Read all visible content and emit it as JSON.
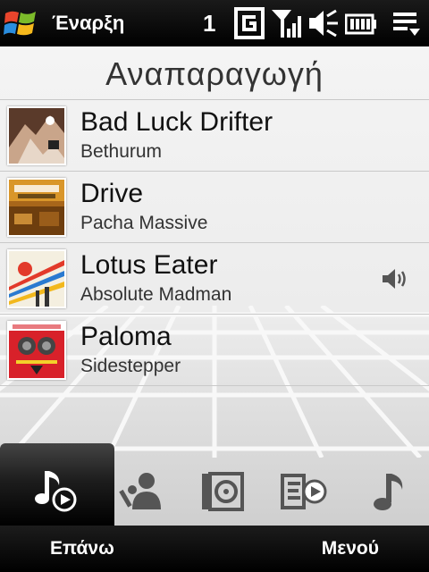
{
  "status_bar": {
    "start_label": "Έναρξη",
    "notification_count": "1",
    "icons": [
      "windows-logo",
      "gprs-icon",
      "signal-icon",
      "volume-muted-icon",
      "battery-icon",
      "menu-icon"
    ]
  },
  "page": {
    "title": "Αναπαραγωγή"
  },
  "playlist": [
    {
      "title": "Bad Luck Drifter",
      "artist": "Bethurum",
      "cover": "album-cover-bethurum",
      "playing": false
    },
    {
      "title": "Drive",
      "artist": "Pacha Massive",
      "cover": "album-cover-pacha-massive",
      "playing": false
    },
    {
      "title": "Lotus Eater",
      "artist": "Absolute Madman",
      "cover": "album-cover-absolute-madman",
      "playing": true
    },
    {
      "title": "Paloma",
      "artist": "Sidestepper",
      "cover": "album-cover-sidestepper",
      "playing": false
    }
  ],
  "tabs": [
    {
      "icon": "now-playing-icon",
      "active": true
    },
    {
      "icon": "artists-icon",
      "active": false
    },
    {
      "icon": "albums-icon",
      "active": false
    },
    {
      "icon": "playlists-icon",
      "active": false
    },
    {
      "icon": "songs-icon",
      "active": false
    }
  ],
  "softkeys": {
    "left": "Επάνω",
    "right": "Μενού"
  },
  "colors": {
    "bar_background": "#000000",
    "content_background": "#ececec",
    "active_tab": "#1d1d1d"
  }
}
